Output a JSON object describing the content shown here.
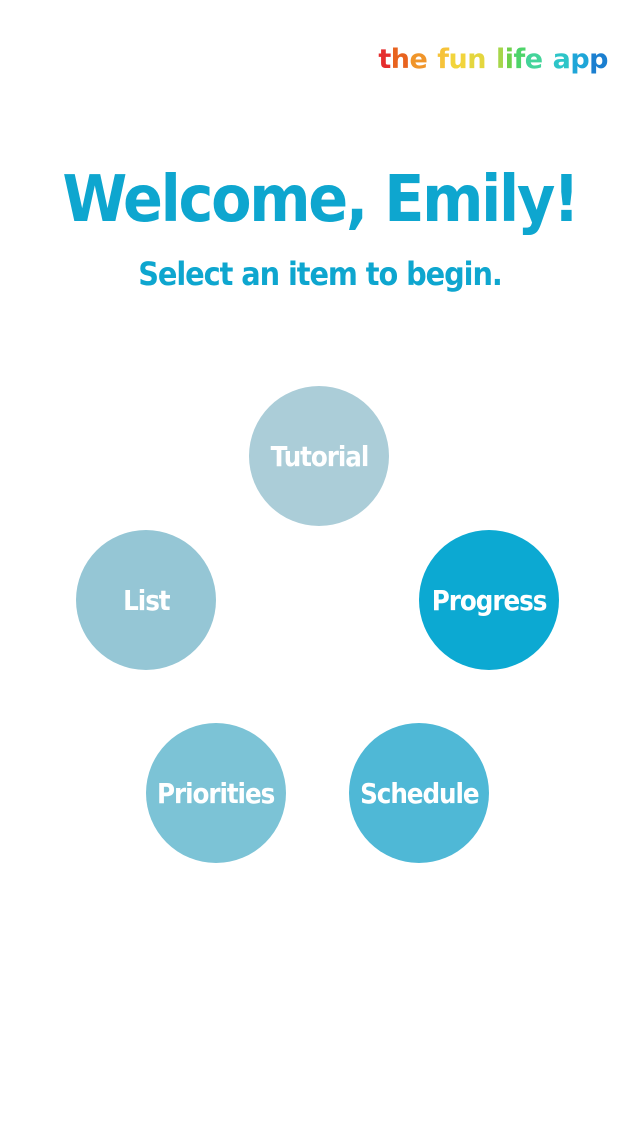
{
  "logo": {
    "letters": [
      {
        "ch": "t",
        "color": "#e52d2d"
      },
      {
        "ch": "h",
        "color": "#e8631f"
      },
      {
        "ch": "e",
        "color": "#f0952a"
      },
      {
        "ch": " ",
        "color": ""
      },
      {
        "ch": "f",
        "color": "#f6c33a"
      },
      {
        "ch": "u",
        "color": "#f2d43c"
      },
      {
        "ch": "n",
        "color": "#e4d63e"
      },
      {
        "ch": " ",
        "color": ""
      },
      {
        "ch": "l",
        "color": "#a6d64a"
      },
      {
        "ch": "i",
        "color": "#6fd04c"
      },
      {
        "ch": "f",
        "color": "#4ed46a"
      },
      {
        "ch": "e",
        "color": "#44d49a"
      },
      {
        "ch": " ",
        "color": ""
      },
      {
        "ch": "a",
        "color": "#2ec5c8"
      },
      {
        "ch": "p",
        "color": "#1fa6d8"
      },
      {
        "ch": "p",
        "color": "#1b7fd0"
      }
    ]
  },
  "header": {
    "title": "Welcome, Emily!",
    "subtitle": "Select an item to begin.",
    "text_color": "#0ea6cf"
  },
  "menu": {
    "tutorial": {
      "label": "Tutorial",
      "color": "#abcdd8"
    },
    "list": {
      "label": "List",
      "color": "#95c6d5"
    },
    "progress": {
      "label": "Progress",
      "color": "#0ca9d2"
    },
    "priorities": {
      "label": "Priorities",
      "color": "#7cc3d6"
    },
    "schedule": {
      "label": "Schedule",
      "color": "#4fb8d6"
    }
  }
}
